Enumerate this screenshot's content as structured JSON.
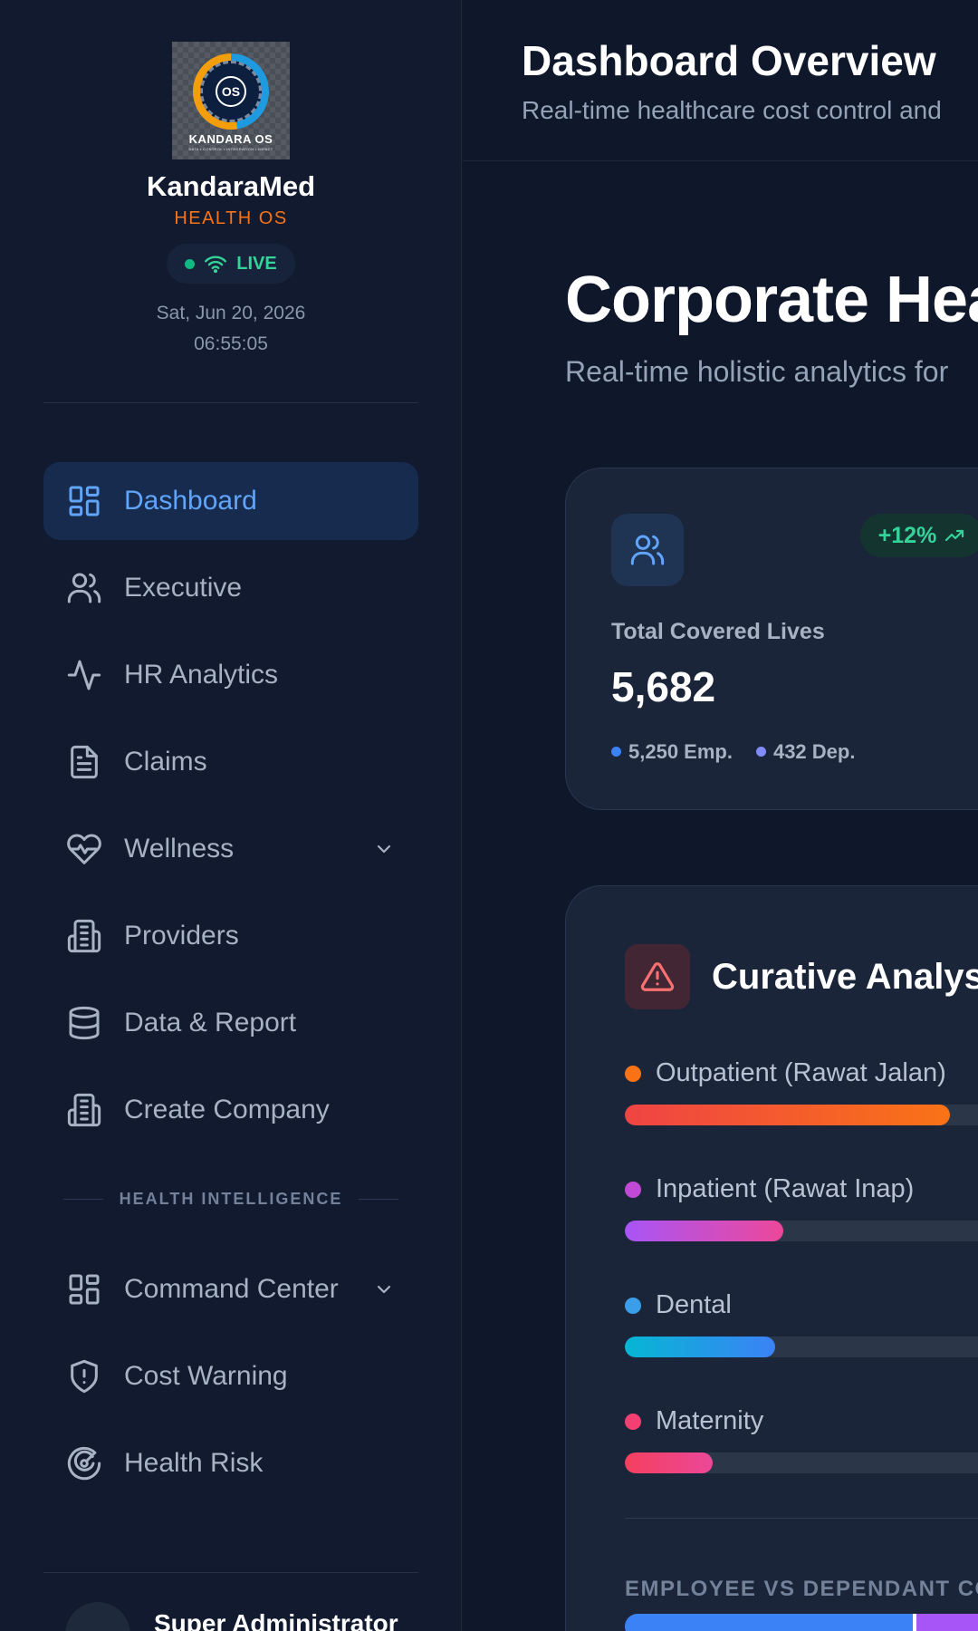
{
  "sidebar": {
    "logo": {
      "word": "KANDARA OS",
      "tagline": "DATA • CONTROL • INTEGRATION • IMPACT",
      "badge": "OS"
    },
    "brand_name": "KandaraMed",
    "brand_sub": "HEALTH OS",
    "live_label": "LIVE",
    "date": "Sat, Jun 20, 2026",
    "time": "06:55:05",
    "nav": [
      {
        "label": "Dashboard",
        "icon": "dashboard-grid-icon",
        "active": true
      },
      {
        "label": "Executive",
        "icon": "users-icon"
      },
      {
        "label": "HR Analytics",
        "icon": "activity-pulse-icon"
      },
      {
        "label": "Claims",
        "icon": "document-icon"
      },
      {
        "label": "Wellness",
        "icon": "heart-pulse-icon",
        "has_dropdown": true
      },
      {
        "label": "Providers",
        "icon": "building-icon"
      },
      {
        "label": "Data & Report",
        "icon": "database-icon"
      },
      {
        "label": "Create Company",
        "icon": "building-icon"
      }
    ],
    "section_label": "HEALTH INTELLIGENCE",
    "nav2": [
      {
        "label": "Command Center",
        "icon": "dashboard-grid-icon",
        "has_dropdown": true
      },
      {
        "label": "Cost Warning",
        "icon": "shield-alert-icon"
      },
      {
        "label": "Health Risk",
        "icon": "radar-target-icon"
      }
    ],
    "user_name": "Super Administrator"
  },
  "header": {
    "title": "Dashboard Overview",
    "subtitle": "Real-time healthcare cost control and"
  },
  "hero": {
    "title": "Corporate Hea",
    "subtitle": "Real-time holistic analytics for"
  },
  "stat_card": {
    "trend": "+12%",
    "label": "Total Covered Lives",
    "value": "5,682",
    "employees": "5,250 Emp.",
    "dependants": "432 Dep."
  },
  "curative": {
    "title": "Curative Analysi",
    "bars": [
      {
        "label": "Outpatient (Rawat Jalan)",
        "fill": 0.78,
        "dot": "#f97316",
        "from": "#ef4444",
        "to": "#f97316"
      },
      {
        "label": "Inpatient (Rawat Inap)",
        "fill": 0.38,
        "dot": "#c04ad6",
        "from": "#a855f7",
        "to": "#ec4899"
      },
      {
        "label": "Dental",
        "fill": 0.36,
        "dot": "#3b9ee8",
        "from": "#06b6d4",
        "to": "#3b82f6"
      },
      {
        "label": "Maternity",
        "fill": 0.21,
        "dot": "#f43f73",
        "from": "#f43f5e",
        "to": "#ec4899"
      }
    ],
    "emp_dep_label": "EMPLOYEE VS DEPENDANT COS",
    "emp_share": 0.695
  },
  "colors": {
    "background": "#0f172a",
    "sidebar": "#111a2e",
    "accent_blue": "#60a5fa",
    "accent_orange": "#f97316",
    "live_green": "#34d399"
  }
}
